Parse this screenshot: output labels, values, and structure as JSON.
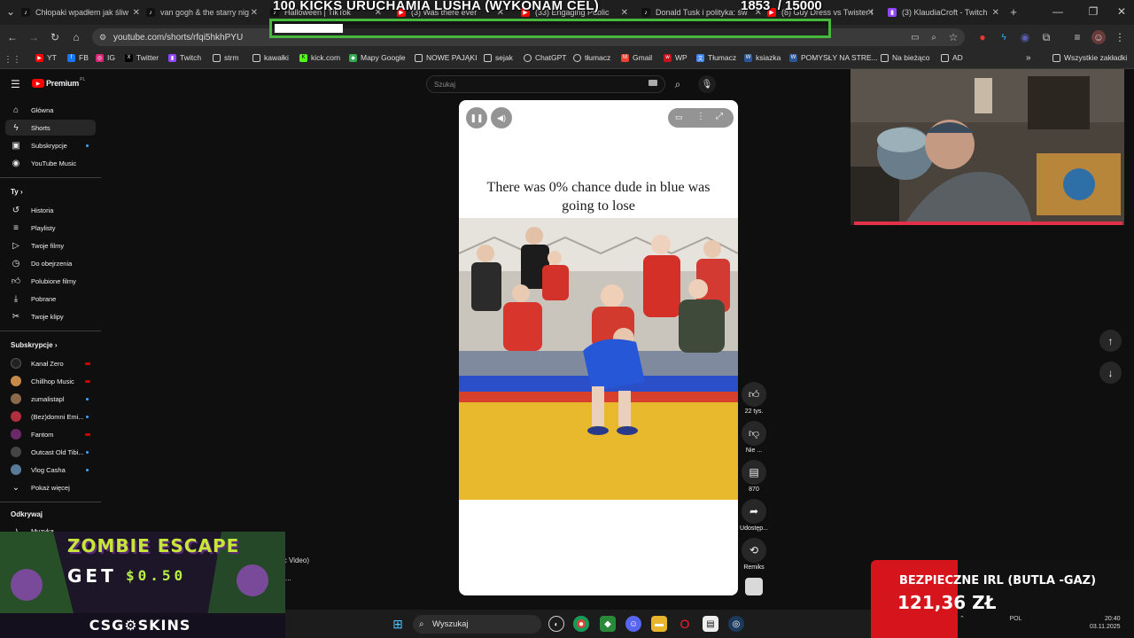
{
  "browser": {
    "tabs": [
      {
        "title": "Chłopaki wpadłem jak śliw",
        "icon": "tiktok-icon",
        "color": "#111111"
      },
      {
        "title": "van gogh & the starry nig",
        "icon": "tiktok-icon",
        "color": "#111111"
      },
      {
        "title": "Halloween | TikTok",
        "icon": "tiktok-icon",
        "color": "#111111"
      },
      {
        "title": "(3) Was there ever",
        "icon": "youtube-icon",
        "color": "#ff0000"
      },
      {
        "title": "(33) Engaging Public",
        "icon": "youtube-icon",
        "color": "#ff0000"
      },
      {
        "title": "Donald Tusk i polityka: św",
        "icon": "tiktok-icon",
        "color": "#111111"
      },
      {
        "title": "(8) Guy Dress vs Twister I",
        "icon": "youtube-icon",
        "color": "#ff0000"
      },
      {
        "title": "(3) KlaudiaCroft - Twitch",
        "icon": "twitch-icon",
        "color": "#9146ff"
      }
    ],
    "url": "youtube.com/shorts/rfqi5hkhPYU",
    "bookmarks": [
      {
        "label": "YT",
        "icon": "youtube-icon",
        "color": "#ff0000"
      },
      {
        "label": "FB",
        "icon": "facebook-icon",
        "color": "#1877f2"
      },
      {
        "label": "IG",
        "icon": "instagram-icon",
        "color": "#d62976"
      },
      {
        "label": "Twitter",
        "icon": "x-icon",
        "color": "#000000"
      },
      {
        "label": "Twitch",
        "icon": "twitch-icon",
        "color": "#9146ff"
      },
      {
        "label": "strm",
        "icon": "folder-icon",
        "color": "#3a3a3a"
      },
      {
        "label": "kawałki",
        "icon": "folder-icon",
        "color": "#3a3a3a"
      },
      {
        "label": "kick.com",
        "icon": "kick-icon",
        "color": "#53fc18"
      },
      {
        "label": "Mapy Google",
        "icon": "maps-icon",
        "color": "#34a853"
      },
      {
        "label": "NOWE PAJĄKI",
        "icon": "folder-icon",
        "color": "#3a3a3a"
      },
      {
        "label": "sejak",
        "icon": "folder-icon",
        "color": "#3a3a3a"
      },
      {
        "label": "ChatGPT",
        "icon": "chatgpt-icon",
        "color": "#3a3a3a"
      },
      {
        "label": "tłumacz",
        "icon": "chatgpt-icon",
        "color": "#3a3a3a"
      },
      {
        "label": "Gmail",
        "icon": "gmail-icon",
        "color": "#ea4335"
      },
      {
        "label": "WP",
        "icon": "wp-icon",
        "color": "#c4151c"
      },
      {
        "label": "Tłumacz",
        "icon": "translate-icon",
        "color": "#4285f4"
      },
      {
        "label": "ksiazka",
        "icon": "word-icon",
        "color": "#2b579a"
      },
      {
        "label": "POMYSŁY NA STRE...",
        "icon": "word-icon",
        "color": "#2b579a"
      },
      {
        "label": "Na bieżąco",
        "icon": "folder-icon",
        "color": "#3a3a3a"
      },
      {
        "label": "AD",
        "icon": "folder-icon",
        "color": "#3a3a3a"
      }
    ],
    "all_bookmarks": "Wszystkie zakładki"
  },
  "overlay": {
    "title": "100 KICKS URUCHAMIA LUSHA (WYKONAM CEL)",
    "goal_current": "1853",
    "goal_target": "/ 15000",
    "goal_progress": 0.1235
  },
  "youtube": {
    "logo": "Premium",
    "logo_badge": "PL",
    "nav": [
      {
        "label": "Główna",
        "icon": "home-icon"
      },
      {
        "label": "Shorts",
        "icon": "shorts-icon",
        "active": true
      },
      {
        "label": "Subskrypcje",
        "icon": "subscriptions-icon"
      },
      {
        "label": "YouTube Music",
        "icon": "music-icon"
      }
    ],
    "you_heading": "Ty",
    "you_items": [
      {
        "label": "Historia",
        "icon": "history-icon"
      },
      {
        "label": "Playlisty",
        "icon": "playlist-icon"
      },
      {
        "label": "Twoje filmy",
        "icon": "video-icon"
      },
      {
        "label": "Do obejrzenia",
        "icon": "clock-icon"
      },
      {
        "label": "Polubione filmy",
        "icon": "like-icon"
      },
      {
        "label": "Pobrane",
        "icon": "download-icon"
      },
      {
        "label": "Twoje klipy",
        "icon": "scissors-icon"
      }
    ],
    "subs_heading": "Subskrypcje",
    "subscriptions": [
      {
        "label": "Kanał Zero",
        "color": "#222222",
        "live": true
      },
      {
        "label": "Chillhop Music",
        "color": "#c88a4a",
        "live": true
      },
      {
        "label": "zumalistapl",
        "color": "#8a6a4a",
        "live": false
      },
      {
        "label": "(Bez)domni Emi...",
        "color": "#b03040",
        "live": false
      },
      {
        "label": "Fantom",
        "color": "#6a2a6a",
        "live": true
      },
      {
        "label": "Outcast Old Tibi...",
        "color": "#444444",
        "live": false
      },
      {
        "label": "Vlog Casha",
        "color": "#5a7a9a",
        "live": false
      }
    ],
    "show_more": "Pokaż więcej",
    "explore_heading": "Odkrywaj",
    "explore_items": [
      {
        "label": "Muzyka",
        "icon": "music-note-icon"
      }
    ],
    "search_placeholder": "Szukaj",
    "video_caption": "There was 0% chance dude in blue was going to lose",
    "actions": [
      {
        "icon": "like-icon",
        "label": "22 tys."
      },
      {
        "icon": "dislike-icon",
        "label": "Nie ..."
      },
      {
        "icon": "comment-icon",
        "label": "870"
      },
      {
        "icon": "share-icon",
        "label": "Udostęp..."
      },
      {
        "icon": "remix-icon",
        "label": "Remiks"
      }
    ],
    "hidden_text_1": "ic Video)",
    "hidden_text_2": "l ..."
  },
  "ad": {
    "title": "ZOMBIE ESCAPE",
    "get": "GET",
    "price": "$0.50",
    "brand": "CSG⚙SKINS"
  },
  "donation": {
    "title": "BEZPIECZNE IRL (BUTLA -GAZ)",
    "amount": "121,36 ZŁ"
  },
  "taskbar": {
    "search_placeholder": "Wyszukaj",
    "language": "POL",
    "time": "20:40",
    "date": "03.11.2025"
  },
  "colors": {
    "accent": "#ff0000",
    "goal_border": "#46b83b",
    "webcam_bar": "#e5304a",
    "donation_red": "#d6141c"
  }
}
